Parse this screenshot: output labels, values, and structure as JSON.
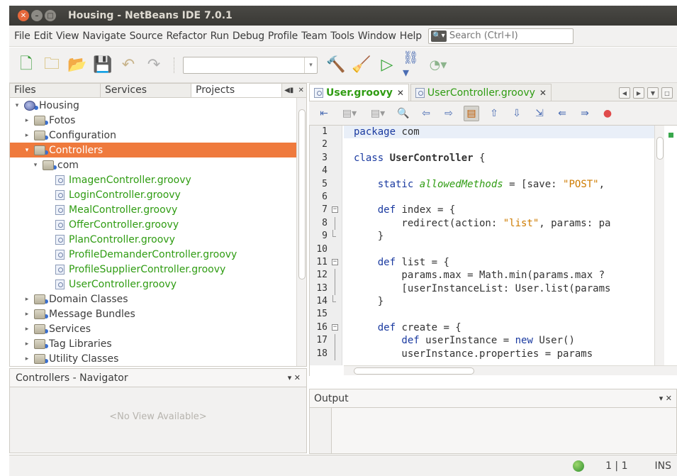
{
  "window": {
    "title": "Housing - NetBeans IDE 7.0.1"
  },
  "menu": {
    "items": [
      "File",
      "Edit",
      "View",
      "Navigate",
      "Source",
      "Refactor",
      "Run",
      "Debug",
      "Profile",
      "Team",
      "Tools",
      "Window",
      "Help"
    ],
    "search_placeholder": "Search (Ctrl+I)"
  },
  "projects": {
    "tabs": [
      "Files",
      "Services",
      "Projects"
    ],
    "tree": [
      {
        "label": "Housing",
        "level": 0,
        "twisty": "▾",
        "icon": "project"
      },
      {
        "label": "Fotos",
        "level": 1,
        "twisty": "▸",
        "icon": "folder"
      },
      {
        "label": "Configuration",
        "level": 1,
        "twisty": "▸",
        "icon": "folder"
      },
      {
        "label": "Controllers",
        "level": 1,
        "twisty": "▾",
        "icon": "folder",
        "selected": true
      },
      {
        "label": "com",
        "level": 2,
        "twisty": "▾",
        "icon": "package"
      },
      {
        "label": "ImagenController.groovy",
        "level": 3,
        "icon": "groovy"
      },
      {
        "label": "LoginController.groovy",
        "level": 3,
        "icon": "groovy"
      },
      {
        "label": "MealController.groovy",
        "level": 3,
        "icon": "groovy"
      },
      {
        "label": "OfferController.groovy",
        "level": 3,
        "icon": "groovy"
      },
      {
        "label": "PlanController.groovy",
        "level": 3,
        "icon": "groovy"
      },
      {
        "label": "ProfileDemanderController.groovy",
        "level": 3,
        "icon": "groovy"
      },
      {
        "label": "ProfileSupplierController.groovy",
        "level": 3,
        "icon": "groovy"
      },
      {
        "label": "UserController.groovy",
        "level": 3,
        "icon": "groovy"
      },
      {
        "label": "Domain Classes",
        "level": 1,
        "twisty": "▸",
        "icon": "folder"
      },
      {
        "label": "Message Bundles",
        "level": 1,
        "twisty": "▸",
        "icon": "folder"
      },
      {
        "label": "Services",
        "level": 1,
        "twisty": "▸",
        "icon": "folder"
      },
      {
        "label": "Tag Libraries",
        "level": 1,
        "twisty": "▸",
        "icon": "folder"
      },
      {
        "label": "Utility Classes",
        "level": 1,
        "twisty": "▸",
        "icon": "folder"
      }
    ]
  },
  "navigator": {
    "title": "Controllers - Navigator",
    "empty": "<No View Available>"
  },
  "editor": {
    "tabs": [
      "User.groovy",
      "UserController.groovy"
    ],
    "lines": [
      [
        {
          "t": "package ",
          "c": "kw"
        },
        {
          "t": "com"
        }
      ],
      [],
      [
        {
          "t": "class ",
          "c": "kw"
        },
        {
          "t": "UserController",
          "c": "bold"
        },
        {
          "t": " {"
        }
      ],
      [],
      [
        {
          "t": "    static ",
          "c": "kw"
        },
        {
          "t": "allowedMethods",
          "c": "it"
        },
        {
          "t": " = [save: "
        },
        {
          "t": "\"POST\"",
          "c": "str"
        },
        {
          "t": ","
        }
      ],
      [],
      [
        {
          "t": "    def ",
          "c": "kw"
        },
        {
          "t": "index = {"
        }
      ],
      [
        {
          "t": "        redirect(action: "
        },
        {
          "t": "\"list\"",
          "c": "str"
        },
        {
          "t": ", params: pa"
        }
      ],
      [
        {
          "t": "    }"
        }
      ],
      [],
      [
        {
          "t": "    def ",
          "c": "kw"
        },
        {
          "t": "list = {"
        }
      ],
      [
        {
          "t": "        params.max = Math.min(params.max ?"
        }
      ],
      [
        {
          "t": "        [userInstanceList: User.list(params"
        }
      ],
      [
        {
          "t": "    }"
        }
      ],
      [],
      [
        {
          "t": "    def ",
          "c": "kw"
        },
        {
          "t": "create = {"
        }
      ],
      [
        {
          "t": "        def ",
          "c": "kw"
        },
        {
          "t": "userInstance = "
        },
        {
          "t": "new ",
          "c": "kw"
        },
        {
          "t": "User()"
        }
      ],
      [
        {
          "t": "        userInstance.properties = params"
        }
      ]
    ],
    "folds": {
      "7": "start",
      "8": "line",
      "9": "end",
      "11": "start",
      "12": "line",
      "13": "line",
      "14": "end",
      "16": "start",
      "17": "line",
      "18": "line"
    }
  },
  "output": {
    "title": "Output"
  },
  "status": {
    "position": "1 | 1",
    "mode": "INS"
  },
  "colors": {
    "selection": "#ef7a3d",
    "titlebar": "#3c3b37",
    "keyword": "#1a3aa0",
    "string": "#ce7b00",
    "groovy_file": "#2f9c12"
  }
}
